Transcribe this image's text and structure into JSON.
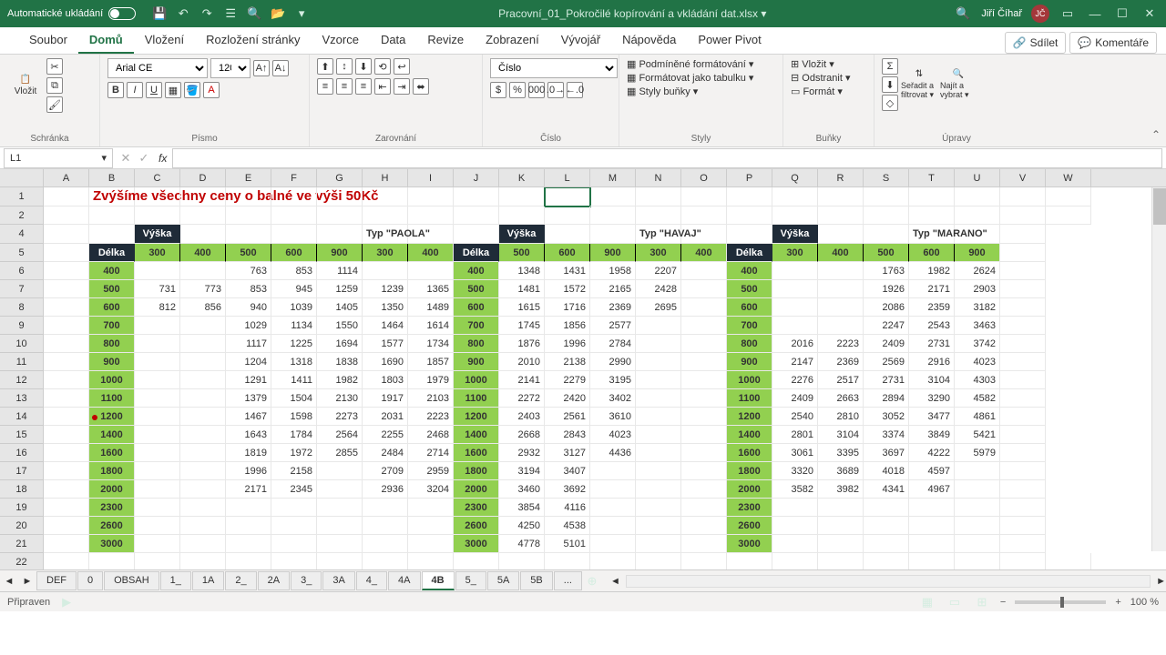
{
  "title_bar": {
    "autosave_label": "Automatické ukládání",
    "filename": "Pracovní_01_Pokročilé kopírování a vkládání dat.xlsx  ▾",
    "user_name": "Jiří Číhař",
    "user_initials": "JČ"
  },
  "menu": {
    "items": [
      "Soubor",
      "Domů",
      "Vložení",
      "Rozložení stránky",
      "Vzorce",
      "Data",
      "Revize",
      "Zobrazení",
      "Vývojář",
      "Nápověda",
      "Power Pivot"
    ],
    "active": 1,
    "share": "Sdílet",
    "comments": "Komentáře"
  },
  "ribbon": {
    "clipboard": {
      "paste": "Vložit",
      "label": "Schránka"
    },
    "font": {
      "name": "Arial CE",
      "size": "120",
      "label": "Písmo"
    },
    "alignment": {
      "label": "Zarovnání"
    },
    "number": {
      "format": "Číslo",
      "label": "Číslo"
    },
    "styles": {
      "cond": "Podmíněné formátování ▾",
      "table": "Formátovat jako tabulku ▾",
      "cell": "Styly buňky ▾",
      "label": "Styly"
    },
    "cells": {
      "insert": "Vložit ▾",
      "delete": "Odstranit ▾",
      "format": "Formát ▾",
      "label": "Buňky"
    },
    "editing": {
      "sort": "Seřadit a filtrovat ▾",
      "find": "Najít a vybrat ▾",
      "label": "Úpravy"
    }
  },
  "namebox": "L1",
  "title_text": "Zvýšíme všechny ceny o balné ve výši 50Kč",
  "col_letters": [
    "A",
    "B",
    "C",
    "D",
    "E",
    "F",
    "G",
    "H",
    "I",
    "J",
    "K",
    "L",
    "M",
    "N",
    "O",
    "P",
    "Q",
    "R",
    "S",
    "T",
    "U",
    "V",
    "W"
  ],
  "row_nums": [
    "1",
    "2",
    "4",
    "5",
    "6",
    "7",
    "8",
    "9",
    "10",
    "11",
    "12",
    "13",
    "14",
    "15",
    "16",
    "17",
    "18",
    "19",
    "20",
    "21",
    "22"
  ],
  "labels": {
    "vyska": "Výška",
    "delka": "Délka"
  },
  "types": [
    "Typ \"PAOLA\"",
    "Typ \"HAVAJ\"",
    "Typ \"MARANO\""
  ],
  "head_paola": [
    "300",
    "400",
    "500",
    "600",
    "900",
    "300",
    "400"
  ],
  "head_havaj": [
    "500",
    "600",
    "900",
    "300",
    "400"
  ],
  "head_marano": [
    "300",
    "400",
    "500",
    "600",
    "900"
  ],
  "side": [
    "400",
    "500",
    "600",
    "700",
    "800",
    "900",
    "1000",
    "1100",
    "1200",
    "1400",
    "1600",
    "1800",
    "2000",
    "2300",
    "2600",
    "3000"
  ],
  "paola": [
    [
      "",
      "",
      "763",
      "853",
      "1114",
      "",
      ""
    ],
    [
      "731",
      "773",
      "853",
      "945",
      "1259",
      "1239",
      "1365"
    ],
    [
      "812",
      "856",
      "940",
      "1039",
      "1405",
      "1350",
      "1489"
    ],
    [
      "",
      "",
      "1029",
      "1134",
      "1550",
      "1464",
      "1614"
    ],
    [
      "",
      "",
      "1117",
      "1225",
      "1694",
      "1577",
      "1734"
    ],
    [
      "",
      "",
      "1204",
      "1318",
      "1838",
      "1690",
      "1857"
    ],
    [
      "",
      "",
      "1291",
      "1411",
      "1982",
      "1803",
      "1979"
    ],
    [
      "",
      "",
      "1379",
      "1504",
      "2130",
      "1917",
      "2103"
    ],
    [
      "",
      "",
      "1467",
      "1598",
      "2273",
      "2031",
      "2223"
    ],
    [
      "",
      "",
      "1643",
      "1784",
      "2564",
      "2255",
      "2468"
    ],
    [
      "",
      "",
      "1819",
      "1972",
      "2855",
      "2484",
      "2714"
    ],
    [
      "",
      "",
      "1996",
      "2158",
      "",
      "2709",
      "2959"
    ],
    [
      "",
      "",
      "2171",
      "2345",
      "",
      "2936",
      "3204"
    ],
    [
      "",
      "",
      "",
      "",
      "",
      "",
      ""
    ],
    [
      "",
      "",
      "",
      "",
      "",
      "",
      ""
    ],
    [
      "",
      "",
      "",
      "",
      "",
      "",
      ""
    ]
  ],
  "havaj": [
    [
      "1348",
      "1431",
      "1958",
      "2207",
      ""
    ],
    [
      "1481",
      "1572",
      "2165",
      "2428",
      ""
    ],
    [
      "1615",
      "1716",
      "2369",
      "2695",
      ""
    ],
    [
      "1745",
      "1856",
      "2577",
      "",
      ""
    ],
    [
      "1876",
      "1996",
      "2784",
      "",
      ""
    ],
    [
      "2010",
      "2138",
      "2990",
      "",
      ""
    ],
    [
      "2141",
      "2279",
      "3195",
      "",
      ""
    ],
    [
      "2272",
      "2420",
      "3402",
      "",
      ""
    ],
    [
      "2403",
      "2561",
      "3610",
      "",
      ""
    ],
    [
      "2668",
      "2843",
      "4023",
      "",
      ""
    ],
    [
      "2932",
      "3127",
      "4436",
      "",
      ""
    ],
    [
      "3194",
      "3407",
      "",
      "",
      ""
    ],
    [
      "3460",
      "3692",
      "",
      "",
      ""
    ],
    [
      "3854",
      "4116",
      "",
      "",
      ""
    ],
    [
      "4250",
      "4538",
      "",
      "",
      ""
    ],
    [
      "4778",
      "5101",
      "",
      "",
      ""
    ]
  ],
  "marano": [
    [
      "",
      "",
      "1763",
      "1982",
      "2624"
    ],
    [
      "",
      "",
      "1926",
      "2171",
      "2903"
    ],
    [
      "",
      "",
      "2086",
      "2359",
      "3182"
    ],
    [
      "",
      "",
      "2247",
      "2543",
      "3463"
    ],
    [
      "2016",
      "2223",
      "2409",
      "2731",
      "3742"
    ],
    [
      "2147",
      "2369",
      "2569",
      "2916",
      "4023"
    ],
    [
      "2276",
      "2517",
      "2731",
      "3104",
      "4303"
    ],
    [
      "2409",
      "2663",
      "2894",
      "3290",
      "4582"
    ],
    [
      "2540",
      "2810",
      "3052",
      "3477",
      "4861"
    ],
    [
      "2801",
      "3104",
      "3374",
      "3849",
      "5421"
    ],
    [
      "3061",
      "3395",
      "3697",
      "4222",
      "5979"
    ],
    [
      "3320",
      "3689",
      "4018",
      "4597",
      ""
    ],
    [
      "3582",
      "3982",
      "4341",
      "4967",
      ""
    ],
    [
      "",
      "",
      "",
      "",
      ""
    ],
    [
      "",
      "",
      "",
      "",
      ""
    ],
    [
      "",
      "",
      "",
      "",
      ""
    ]
  ],
  "sheet_tabs": [
    "DEF",
    "0",
    "OBSAH",
    "1_",
    "1A",
    "2_",
    "2A",
    "3_",
    "3A",
    "4_",
    "4A",
    "4B",
    "5_",
    "5A",
    "5B",
    "..."
  ],
  "active_tab": 11,
  "status": {
    "ready": "Připraven",
    "zoom": "100 %"
  }
}
